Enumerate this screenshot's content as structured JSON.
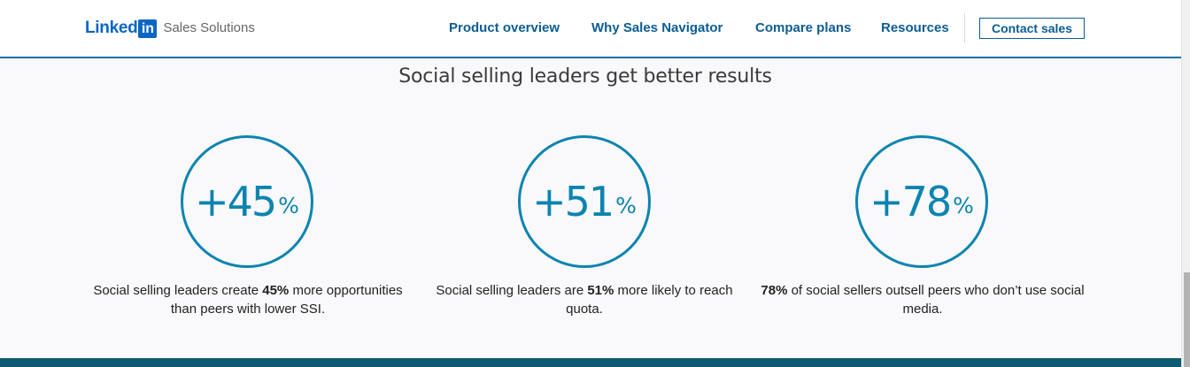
{
  "header": {
    "logo_text": "Linked",
    "logo_badge": "in",
    "logo_subtitle": "Sales Solutions",
    "nav": [
      {
        "label": "Product overview"
      },
      {
        "label": "Why Sales Navigator"
      },
      {
        "label": "Compare plans"
      },
      {
        "label": "Resources"
      }
    ],
    "cta_label": "Contact sales"
  },
  "section": {
    "title": "Social selling leaders get better results",
    "stats": [
      {
        "value": "+45",
        "unit": "%",
        "caption_before": "Social selling leaders create ",
        "caption_bold": "45%",
        "caption_after": " more opportunities than peers with lower SSI."
      },
      {
        "value": "+51",
        "unit": "%",
        "caption_before": "Social selling leaders are ",
        "caption_bold": "51%",
        "caption_after": " more likely to reach quota."
      },
      {
        "value": "+78",
        "unit": "%",
        "caption_before": "",
        "caption_bold": "78%",
        "caption_after": " of social sellers outsell peers who don’t use social media."
      }
    ]
  },
  "colors": {
    "brand_blue": "#0a66c2",
    "nav_blue": "#0b5d92",
    "accent_teal": "#0b84b0",
    "footer_band": "#0e5a72"
  }
}
